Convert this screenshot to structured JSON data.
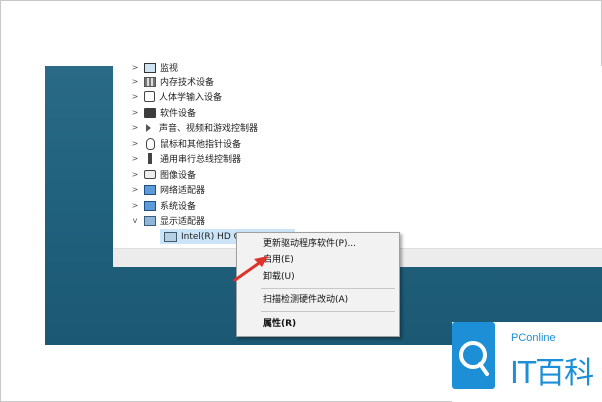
{
  "device_tree": {
    "items": [
      {
        "label": "监视",
        "expander": ">",
        "icon": "monitor-icon"
      },
      {
        "label": "内存技术设备",
        "expander": ">",
        "icon": "memory-device-icon"
      },
      {
        "label": "人体学输入设备",
        "expander": ">",
        "icon": "hid-icon"
      },
      {
        "label": "软件设备",
        "expander": ">",
        "icon": "software-device-icon"
      },
      {
        "label": "声音、视频和游戏控制器",
        "expander": ">",
        "icon": "speaker-icon"
      },
      {
        "label": "鼠标和其他指针设备",
        "expander": ">",
        "icon": "mouse-icon"
      },
      {
        "label": "通用串行总线控制器",
        "expander": ">",
        "icon": "usb-icon"
      },
      {
        "label": "图像设备",
        "expander": ">",
        "icon": "camera-icon"
      },
      {
        "label": "网络适配器",
        "expander": ">",
        "icon": "network-adapter-icon"
      },
      {
        "label": "系统设备",
        "expander": ">",
        "icon": "system-device-icon"
      },
      {
        "label": "显示适配器",
        "expander": "v",
        "icon": "display-adapter-icon"
      }
    ],
    "selected_child": {
      "label": "Intel(R) HD G",
      "icon": "gpu-icon"
    }
  },
  "context_menu": {
    "update_driver": "更新驱动程序软件(P)...",
    "enable": "启用(E)",
    "uninstall": "卸载(U)",
    "scan_changes": "扫描检测硬件改动(A)",
    "properties": "属性(R)"
  },
  "watermark": {
    "brand_en": "PConline",
    "brand_cn": "IT百科",
    "color": "#1d8fd6"
  },
  "colors": {
    "desktop": "#21627e",
    "selection": "#cce4f7",
    "arrow": "#e0322b"
  }
}
